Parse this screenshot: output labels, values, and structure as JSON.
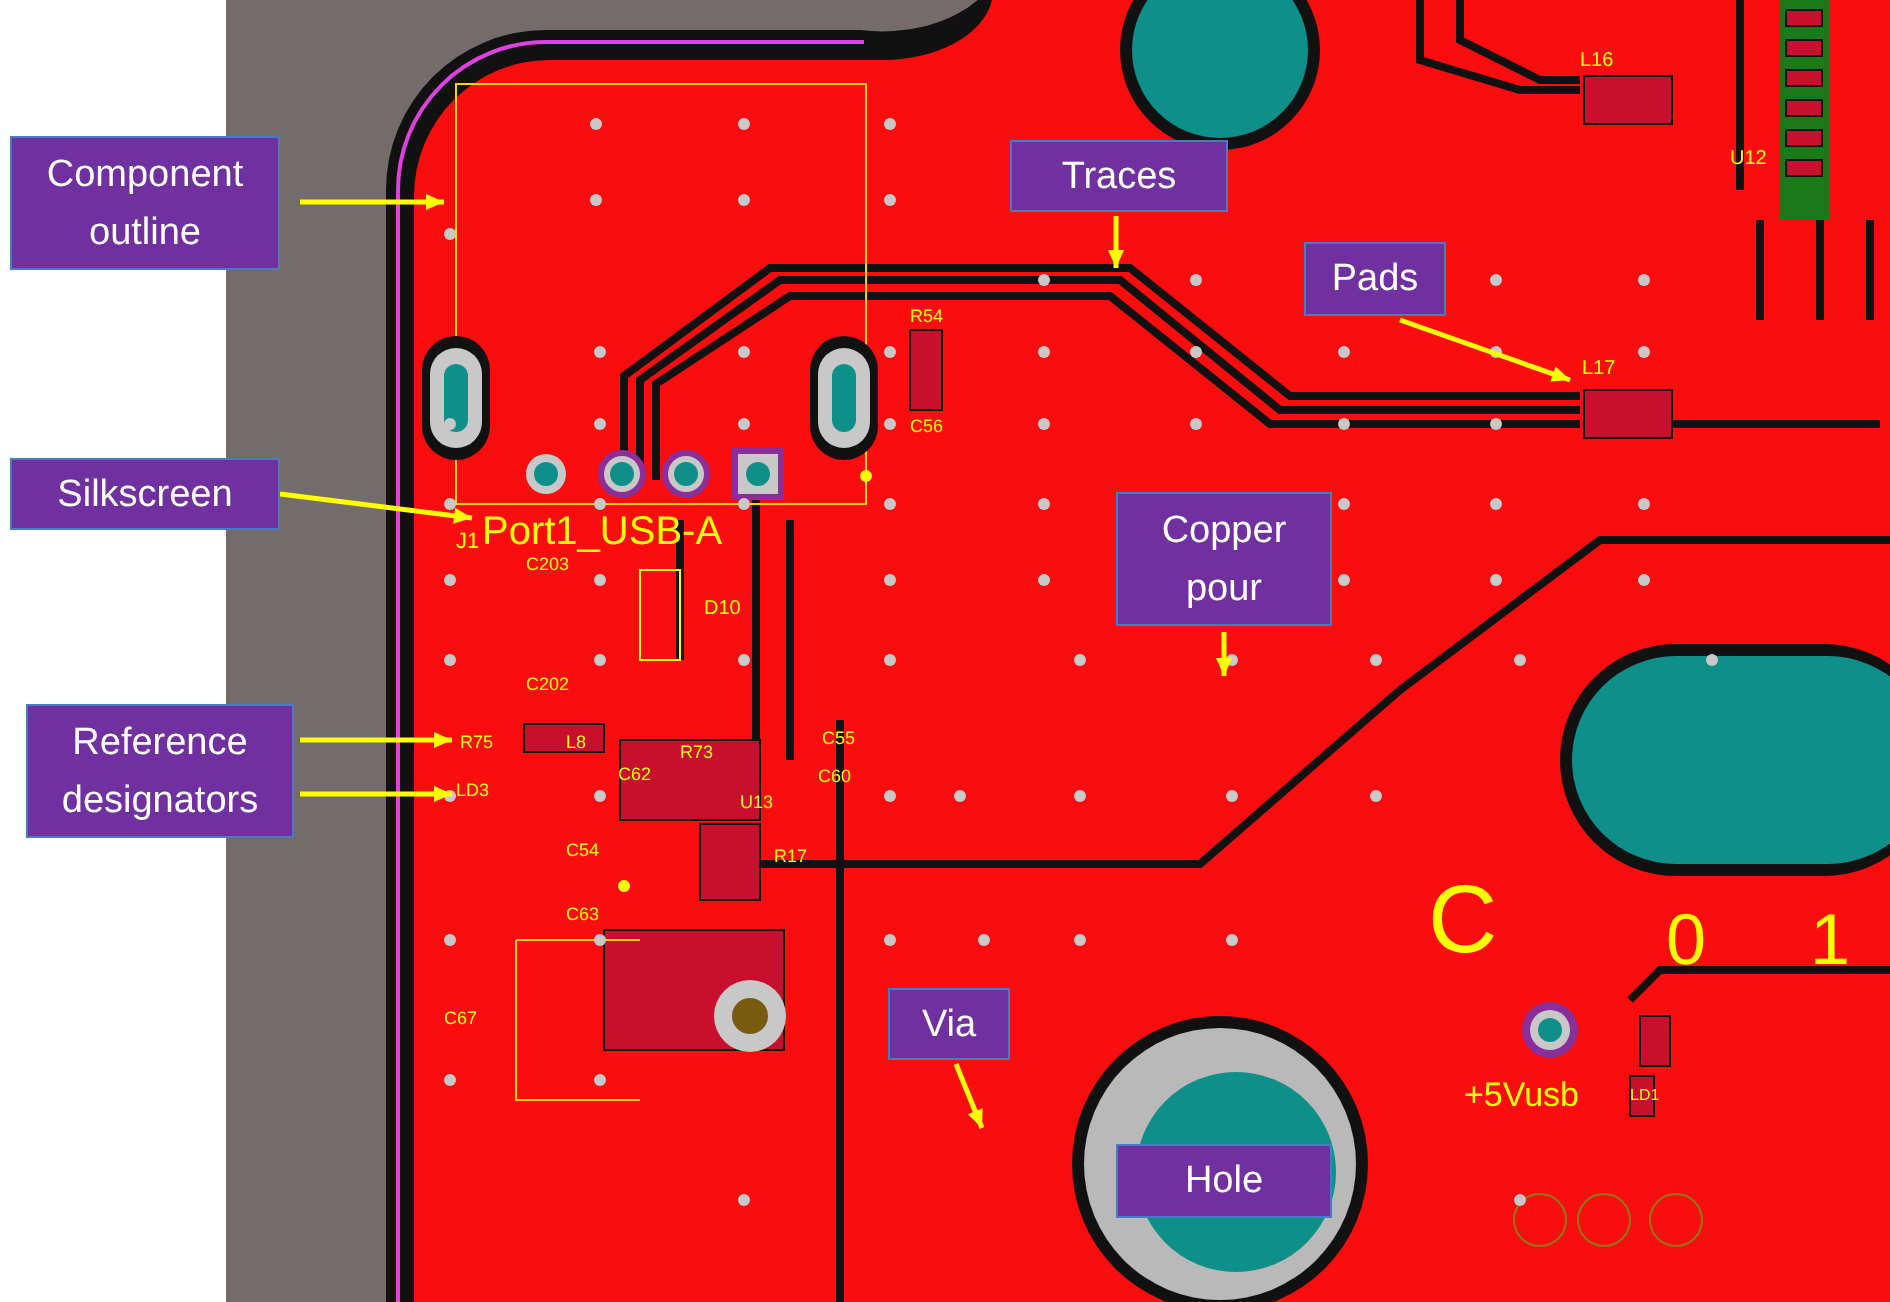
{
  "callouts": [
    {
      "label": "Component outline"
    },
    {
      "label": "Traces"
    },
    {
      "label": "Pads"
    },
    {
      "label": "Silkscreen"
    },
    {
      "label": "Copper pour"
    },
    {
      "label": "Reference designators"
    },
    {
      "label": "Via"
    },
    {
      "label": "Hole"
    }
  ],
  "designators": [
    {
      "text": "J1"
    },
    {
      "text": "Port1_USB-A"
    },
    {
      "text": "R54"
    },
    {
      "text": "C56"
    },
    {
      "text": "C203"
    },
    {
      "text": "C202"
    },
    {
      "text": "D10"
    },
    {
      "text": "R75"
    },
    {
      "text": "L8"
    },
    {
      "text": "LD3"
    },
    {
      "text": "C62"
    },
    {
      "text": "R73"
    },
    {
      "text": "C55"
    },
    {
      "text": "C60"
    },
    {
      "text": "U13"
    },
    {
      "text": "R17"
    },
    {
      "text": "C54"
    },
    {
      "text": "C63"
    },
    {
      "text": "C67"
    },
    {
      "text": "L16"
    },
    {
      "text": "L17"
    },
    {
      "text": "U12"
    },
    {
      "text": "C"
    },
    {
      "text": "0"
    },
    {
      "text": "1"
    },
    {
      "text": "+5Vusb"
    },
    {
      "text": "LD1"
    }
  ]
}
